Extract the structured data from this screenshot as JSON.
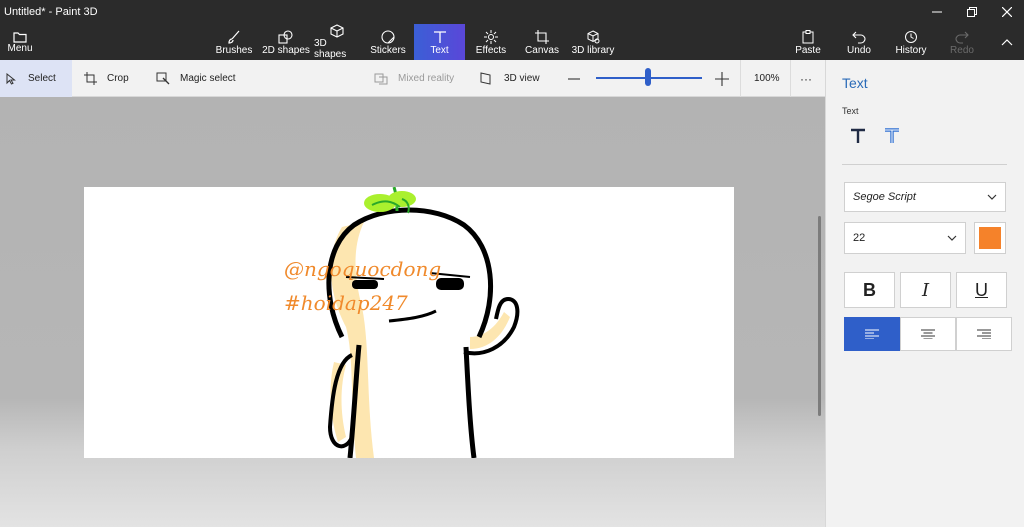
{
  "window": {
    "title": "Untitled* - Paint 3D"
  },
  "menu": {
    "label": "Menu"
  },
  "ribbon": {
    "tools": [
      {
        "label": "Brushes",
        "icon": "brush-icon"
      },
      {
        "label": "2D shapes",
        "icon": "2d-shapes-icon"
      },
      {
        "label": "3D shapes",
        "icon": "3d-shapes-icon"
      },
      {
        "label": "Stickers",
        "icon": "stickers-icon"
      },
      {
        "label": "Text",
        "icon": "text-icon",
        "active": true
      },
      {
        "label": "Effects",
        "icon": "effects-icon"
      },
      {
        "label": "Canvas",
        "icon": "canvas-icon"
      },
      {
        "label": "3D library",
        "icon": "3d-library-icon"
      }
    ],
    "right": [
      {
        "label": "Paste",
        "icon": "paste-icon"
      },
      {
        "label": "Undo",
        "icon": "undo-icon"
      },
      {
        "label": "History",
        "icon": "history-icon"
      },
      {
        "label": "Redo",
        "icon": "redo-icon",
        "disabled": true
      }
    ]
  },
  "toolbar": {
    "select": "Select",
    "crop": "Crop",
    "magic_select": "Magic select",
    "mixed_reality": "Mixed reality",
    "view_3d": "3D view",
    "zoom_percent": "100%",
    "zoom_level": 0.5,
    "more": "···"
  },
  "canvas": {
    "text_line1": "@ngoquocdong",
    "text_line2": "#hoidap247"
  },
  "panel": {
    "title": "Text",
    "subtitle": "Text",
    "font_family": "Segoe Script",
    "font_size": "22",
    "color": "#f5822a",
    "bold": "B",
    "italic": "I",
    "underline": "U",
    "alignment": "left"
  },
  "colors": {
    "accent": "#2f5fc9",
    "text_active_gradient_start": "#3b5fd6",
    "text_active_gradient_end": "#5a47d8",
    "panel_title": "#2a6bb8",
    "canvas_text": "#f08a2c"
  }
}
